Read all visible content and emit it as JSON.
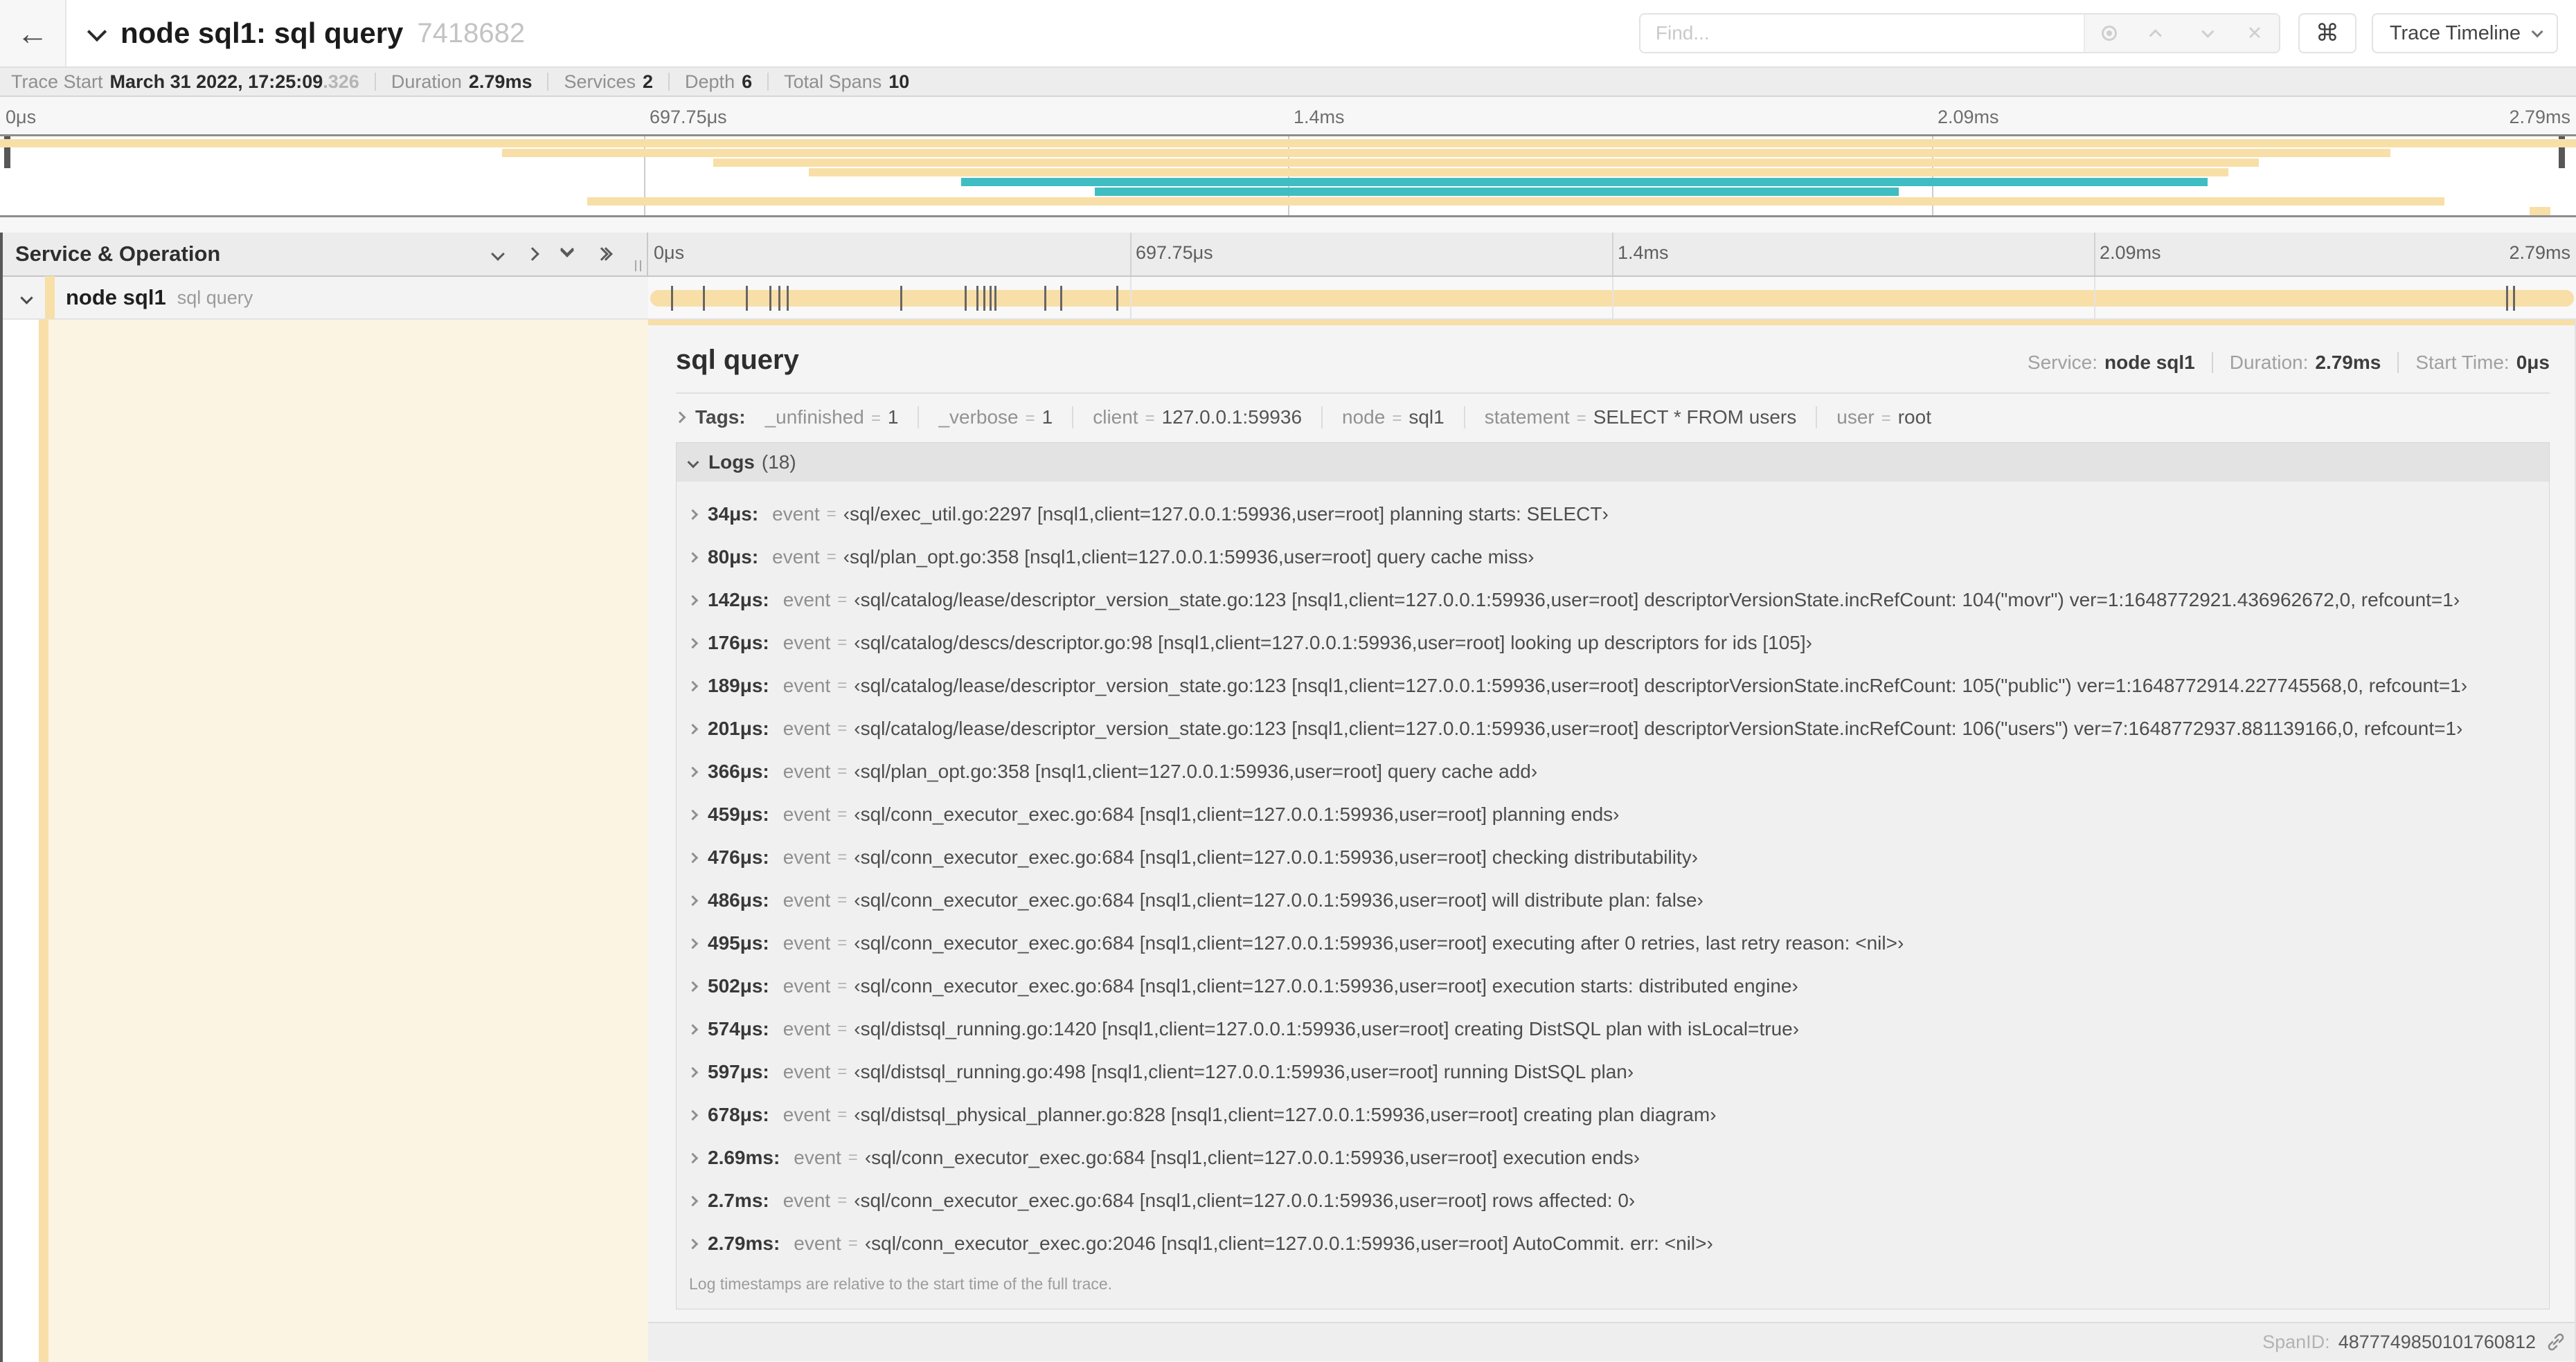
{
  "header": {
    "title": "node sql1: sql query",
    "trace_id": "7418682",
    "find_placeholder": "Find...",
    "shortcut_key": "⌘",
    "view_selector": "Trace Timeline"
  },
  "stats": [
    {
      "label": "Trace Start",
      "value": "March 31 2022, 17:25:09",
      "suffix": ".326"
    },
    {
      "label": "Duration",
      "value": "2.79ms",
      "suffix": ""
    },
    {
      "label": "Services",
      "value": "2",
      "suffix": ""
    },
    {
      "label": "Depth",
      "value": "6",
      "suffix": ""
    },
    {
      "label": "Total Spans",
      "value": "10",
      "suffix": ""
    }
  ],
  "timeline": {
    "header_label": "Service & Operation",
    "duration_us": 2790,
    "ticks": [
      {
        "label": "0μs",
        "frac": 0
      },
      {
        "label": "697.75μs",
        "frac": 0.25
      },
      {
        "label": "1.4ms",
        "frac": 0.5
      },
      {
        "label": "2.09ms",
        "frac": 0.75
      },
      {
        "label": "2.79ms",
        "frac": 1
      }
    ]
  },
  "colors": {
    "span_tan": "#f8dfa8",
    "span_teal": "#3fbdc2",
    "detail_tint": "#fcf4e2",
    "accent": "#f8dfa8"
  },
  "minimap": {
    "spans": [
      {
        "start": 0,
        "end": 1,
        "color": "tan"
      },
      {
        "start": 0.195,
        "end": 0.928,
        "color": "tan"
      },
      {
        "start": 0.277,
        "end": 0.877,
        "color": "tan"
      },
      {
        "start": 0.314,
        "end": 0.865,
        "color": "tan"
      },
      {
        "start": 0.373,
        "end": 0.857,
        "color": "teal"
      },
      {
        "start": 0.425,
        "end": 0.737,
        "color": "teal"
      },
      {
        "start": 0.228,
        "end": 0.949,
        "color": "tan"
      },
      {
        "start": 0.982,
        "end": 0.99,
        "color": "tan"
      }
    ]
  },
  "span_row": {
    "service": "node sql1",
    "operation": "sql query"
  },
  "detail": {
    "title": "sql query",
    "meta": [
      {
        "label": "Service:",
        "value": "node sql1"
      },
      {
        "label": "Duration:",
        "value": "2.79ms"
      },
      {
        "label": "Start Time:",
        "value": "0μs"
      }
    ],
    "tags_label": "Tags:",
    "tags": [
      {
        "key": "_unfinished",
        "value": "1"
      },
      {
        "key": "_verbose",
        "value": "1"
      },
      {
        "key": "client",
        "value": "127.0.0.1:59936"
      },
      {
        "key": "node",
        "value": "sql1"
      },
      {
        "key": "statement",
        "value": "SELECT * FROM users"
      },
      {
        "key": "user",
        "value": "root"
      }
    ],
    "logs": {
      "label": "Logs",
      "count": "(18)",
      "field": "event",
      "entries": [
        {
          "time": "34μs:",
          "t_us": 34,
          "value": "‹sql/exec_util.go:2297 [nsql1,client=127.0.0.1:59936,user=root] planning starts: SELECT›"
        },
        {
          "time": "80μs:",
          "t_us": 80,
          "value": "‹sql/plan_opt.go:358 [nsql1,client=127.0.0.1:59936,user=root] query cache miss›"
        },
        {
          "time": "142μs:",
          "t_us": 142,
          "value": "‹sql/catalog/lease/descriptor_version_state.go:123 [nsql1,client=127.0.0.1:59936,user=root] descriptorVersionState.incRefCount: 104(\"movr\") ver=1:1648772921.436962672,0, refcount=1›"
        },
        {
          "time": "176μs:",
          "t_us": 176,
          "value": "‹sql/catalog/descs/descriptor.go:98 [nsql1,client=127.0.0.1:59936,user=root] looking up descriptors for ids [105]›"
        },
        {
          "time": "189μs:",
          "t_us": 189,
          "value": "‹sql/catalog/lease/descriptor_version_state.go:123 [nsql1,client=127.0.0.1:59936,user=root] descriptorVersionState.incRefCount: 105(\"public\") ver=1:1648772914.227745568,0, refcount=1›"
        },
        {
          "time": "201μs:",
          "t_us": 201,
          "value": "‹sql/catalog/lease/descriptor_version_state.go:123 [nsql1,client=127.0.0.1:59936,user=root] descriptorVersionState.incRefCount: 106(\"users\") ver=7:1648772937.881139166,0, refcount=1›"
        },
        {
          "time": "366μs:",
          "t_us": 366,
          "value": "‹sql/plan_opt.go:358 [nsql1,client=127.0.0.1:59936,user=root] query cache add›"
        },
        {
          "time": "459μs:",
          "t_us": 459,
          "value": "‹sql/conn_executor_exec.go:684 [nsql1,client=127.0.0.1:59936,user=root] planning ends›"
        },
        {
          "time": "476μs:",
          "t_us": 476,
          "value": "‹sql/conn_executor_exec.go:684 [nsql1,client=127.0.0.1:59936,user=root] checking distributability›"
        },
        {
          "time": "486μs:",
          "t_us": 486,
          "value": "‹sql/conn_executor_exec.go:684 [nsql1,client=127.0.0.1:59936,user=root] will distribute plan: false›"
        },
        {
          "time": "495μs:",
          "t_us": 495,
          "value": "‹sql/conn_executor_exec.go:684 [nsql1,client=127.0.0.1:59936,user=root] executing after 0 retries, last retry reason: <nil>›"
        },
        {
          "time": "502μs:",
          "t_us": 502,
          "value": "‹sql/conn_executor_exec.go:684 [nsql1,client=127.0.0.1:59936,user=root] execution starts: distributed engine›"
        },
        {
          "time": "574μs:",
          "t_us": 574,
          "value": "‹sql/distsql_running.go:1420 [nsql1,client=127.0.0.1:59936,user=root] creating DistSQL plan with isLocal=true›"
        },
        {
          "time": "597μs:",
          "t_us": 597,
          "value": "‹sql/distsql_running.go:498 [nsql1,client=127.0.0.1:59936,user=root] running DistSQL plan›"
        },
        {
          "time": "678μs:",
          "t_us": 678,
          "value": "‹sql/distsql_physical_planner.go:828 [nsql1,client=127.0.0.1:59936,user=root] creating plan diagram›"
        },
        {
          "time": "2.69ms:",
          "t_us": 2690,
          "value": "‹sql/conn_executor_exec.go:684 [nsql1,client=127.0.0.1:59936,user=root] execution ends›"
        },
        {
          "time": "2.7ms:",
          "t_us": 2700,
          "value": "‹sql/conn_executor_exec.go:684 [nsql1,client=127.0.0.1:59936,user=root] rows affected: 0›"
        },
        {
          "time": "2.79ms:",
          "t_us": 2790,
          "value": "‹sql/conn_executor_exec.go:2046 [nsql1,client=127.0.0.1:59936,user=root] AutoCommit. err: <nil>›"
        }
      ],
      "note": "Log timestamps are relative to the start time of the full trace."
    },
    "footer": {
      "label": "SpanID:",
      "value": "4877749850101760812"
    }
  }
}
